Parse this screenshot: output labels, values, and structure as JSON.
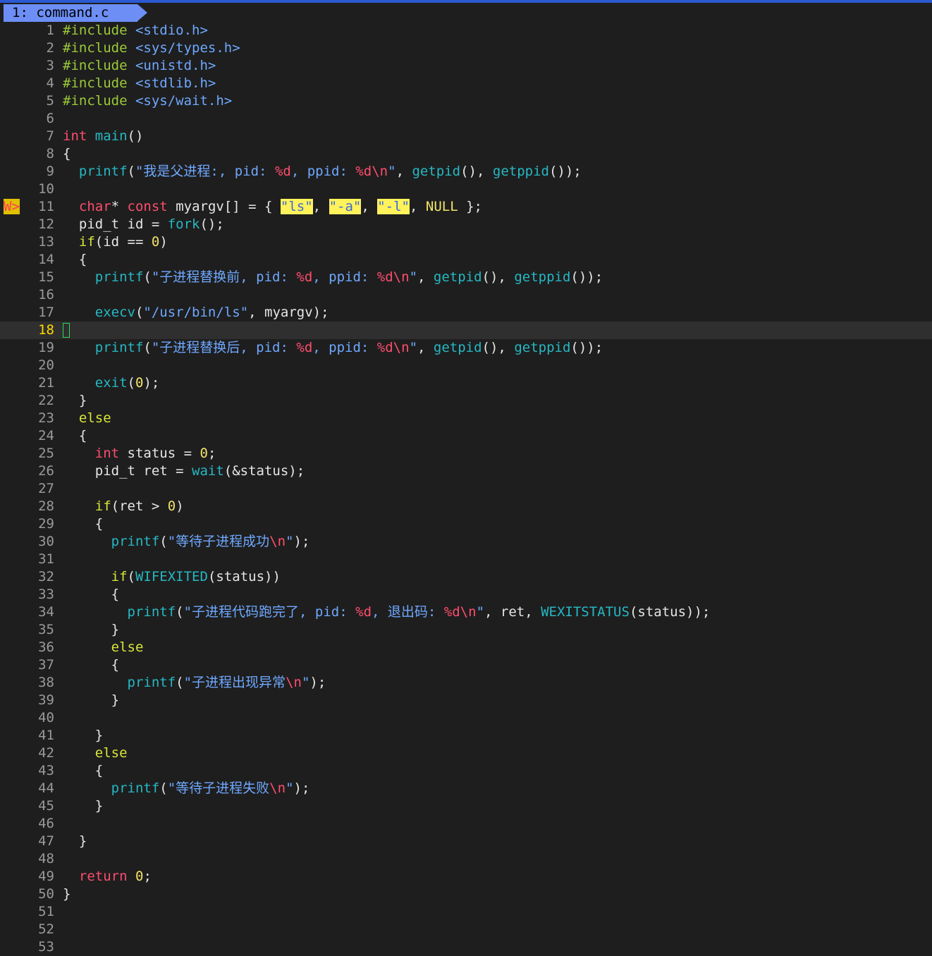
{
  "tab": {
    "label": "1: command.c"
  },
  "sign_marker": "W>",
  "cursor_line": 18,
  "lines": [
    {
      "n": "1",
      "tokens": [
        [
          "t-inc",
          "#include "
        ],
        [
          "t-hdr",
          "<stdio.h>"
        ]
      ]
    },
    {
      "n": "2",
      "tokens": [
        [
          "t-inc",
          "#include "
        ],
        [
          "t-hdr",
          "<sys/types.h>"
        ]
      ]
    },
    {
      "n": "3",
      "tokens": [
        [
          "t-inc",
          "#include "
        ],
        [
          "t-hdr",
          "<unistd.h>"
        ]
      ]
    },
    {
      "n": "4",
      "tokens": [
        [
          "t-inc",
          "#include "
        ],
        [
          "t-hdr",
          "<stdlib.h>"
        ]
      ]
    },
    {
      "n": "5",
      "tokens": [
        [
          "t-inc",
          "#include "
        ],
        [
          "t-hdr",
          "<sys/wait.h>"
        ]
      ]
    },
    {
      "n": "6",
      "tokens": []
    },
    {
      "n": "7",
      "tokens": [
        [
          "t-kw",
          "int "
        ],
        [
          "t-fn",
          "main"
        ],
        [
          "t-pl",
          "()"
        ]
      ]
    },
    {
      "n": "8",
      "tokens": [
        [
          "t-pl",
          "{"
        ]
      ]
    },
    {
      "n": "9",
      "tokens": [
        [
          "t-pl",
          "  "
        ],
        [
          "t-fn",
          "printf"
        ],
        [
          "t-pl",
          "("
        ],
        [
          "t-str",
          "\"我是父进程:, pid: "
        ],
        [
          "t-fmt",
          "%d"
        ],
        [
          "t-str",
          ", ppid: "
        ],
        [
          "t-fmt",
          "%d"
        ],
        [
          "t-esc",
          "\\n"
        ],
        [
          "t-str",
          "\""
        ],
        [
          "t-pl",
          ", "
        ],
        [
          "t-fn",
          "getpid"
        ],
        [
          "t-pl",
          "(), "
        ],
        [
          "t-fn",
          "getppid"
        ],
        [
          "t-pl",
          "());"
        ]
      ]
    },
    {
      "n": "10",
      "tokens": []
    },
    {
      "n": "11",
      "sign": true,
      "tokens": [
        [
          "t-pl",
          "  "
        ],
        [
          "t-kw",
          "char"
        ],
        [
          "t-pl",
          "* "
        ],
        [
          "t-kw",
          "const"
        ],
        [
          "t-pl",
          " myargv[] = { "
        ],
        [
          "t-hl",
          "\"ls\""
        ],
        [
          "t-pl",
          ", "
        ],
        [
          "t-hl",
          "\"-a\""
        ],
        [
          "t-pl",
          ", "
        ],
        [
          "t-hl",
          "\"-l\""
        ],
        [
          "t-pl",
          ", "
        ],
        [
          "t-nul",
          "NULL"
        ],
        [
          "t-pl",
          " };"
        ]
      ]
    },
    {
      "n": "12",
      "tokens": [
        [
          "t-pl",
          "  pid_t id = "
        ],
        [
          "t-fn",
          "fork"
        ],
        [
          "t-pl",
          "();"
        ]
      ]
    },
    {
      "n": "13",
      "tokens": [
        [
          "t-pl",
          "  "
        ],
        [
          "t-ctl",
          "if"
        ],
        [
          "t-pl",
          "(id == "
        ],
        [
          "t-num",
          "0"
        ],
        [
          "t-pl",
          ")"
        ]
      ]
    },
    {
      "n": "14",
      "tokens": [
        [
          "t-pl",
          "  {"
        ]
      ]
    },
    {
      "n": "15",
      "tokens": [
        [
          "t-pl",
          "    "
        ],
        [
          "t-fn",
          "printf"
        ],
        [
          "t-pl",
          "("
        ],
        [
          "t-str",
          "\"子进程替换前, pid: "
        ],
        [
          "t-fmt",
          "%d"
        ],
        [
          "t-str",
          ", ppid: "
        ],
        [
          "t-fmt",
          "%d"
        ],
        [
          "t-esc",
          "\\n"
        ],
        [
          "t-str",
          "\""
        ],
        [
          "t-pl",
          ", "
        ],
        [
          "t-fn",
          "getpid"
        ],
        [
          "t-pl",
          "(), "
        ],
        [
          "t-fn",
          "getppid"
        ],
        [
          "t-pl",
          "());"
        ]
      ]
    },
    {
      "n": "16",
      "tokens": []
    },
    {
      "n": "17",
      "tokens": [
        [
          "t-pl",
          "    "
        ],
        [
          "t-fn",
          "execv"
        ],
        [
          "t-pl",
          "("
        ],
        [
          "t-str",
          "\"/usr/bin/ls\""
        ],
        [
          "t-pl",
          ", myargv);"
        ]
      ]
    },
    {
      "n": "18",
      "tokens": []
    },
    {
      "n": "19",
      "tokens": [
        [
          "t-pl",
          "    "
        ],
        [
          "t-fn",
          "printf"
        ],
        [
          "t-pl",
          "("
        ],
        [
          "t-str",
          "\"子进程替换后, pid: "
        ],
        [
          "t-fmt",
          "%d"
        ],
        [
          "t-str",
          ", ppid: "
        ],
        [
          "t-fmt",
          "%d"
        ],
        [
          "t-esc",
          "\\n"
        ],
        [
          "t-str",
          "\""
        ],
        [
          "t-pl",
          ", "
        ],
        [
          "t-fn",
          "getpid"
        ],
        [
          "t-pl",
          "(), "
        ],
        [
          "t-fn",
          "getppid"
        ],
        [
          "t-pl",
          "());"
        ]
      ]
    },
    {
      "n": "20",
      "tokens": []
    },
    {
      "n": "21",
      "tokens": [
        [
          "t-pl",
          "    "
        ],
        [
          "t-fn",
          "exit"
        ],
        [
          "t-pl",
          "("
        ],
        [
          "t-num",
          "0"
        ],
        [
          "t-pl",
          ");"
        ]
      ]
    },
    {
      "n": "22",
      "tokens": [
        [
          "t-pl",
          "  }"
        ]
      ]
    },
    {
      "n": "23",
      "tokens": [
        [
          "t-pl",
          "  "
        ],
        [
          "t-ctl",
          "else"
        ]
      ]
    },
    {
      "n": "24",
      "tokens": [
        [
          "t-pl",
          "  {"
        ]
      ]
    },
    {
      "n": "25",
      "tokens": [
        [
          "t-pl",
          "    "
        ],
        [
          "t-kw",
          "int"
        ],
        [
          "t-pl",
          " status = "
        ],
        [
          "t-num",
          "0"
        ],
        [
          "t-pl",
          ";"
        ]
      ]
    },
    {
      "n": "26",
      "tokens": [
        [
          "t-pl",
          "    pid_t ret = "
        ],
        [
          "t-fn",
          "wait"
        ],
        [
          "t-pl",
          "(&status);"
        ]
      ]
    },
    {
      "n": "27",
      "tokens": []
    },
    {
      "n": "28",
      "tokens": [
        [
          "t-pl",
          "    "
        ],
        [
          "t-ctl",
          "if"
        ],
        [
          "t-pl",
          "(ret > "
        ],
        [
          "t-num",
          "0"
        ],
        [
          "t-pl",
          ")"
        ]
      ]
    },
    {
      "n": "29",
      "tokens": [
        [
          "t-pl",
          "    {"
        ]
      ]
    },
    {
      "n": "30",
      "tokens": [
        [
          "t-pl",
          "      "
        ],
        [
          "t-fn",
          "printf"
        ],
        [
          "t-pl",
          "("
        ],
        [
          "t-str",
          "\"等待子进程成功"
        ],
        [
          "t-esc",
          "\\n"
        ],
        [
          "t-str",
          "\""
        ],
        [
          "t-pl",
          ");"
        ]
      ]
    },
    {
      "n": "31",
      "tokens": []
    },
    {
      "n": "32",
      "tokens": [
        [
          "t-pl",
          "      "
        ],
        [
          "t-ctl",
          "if"
        ],
        [
          "t-pl",
          "("
        ],
        [
          "t-mac",
          "WIFEXITED"
        ],
        [
          "t-pl",
          "(status))"
        ]
      ]
    },
    {
      "n": "33",
      "tokens": [
        [
          "t-pl",
          "      {"
        ]
      ]
    },
    {
      "n": "34",
      "tokens": [
        [
          "t-pl",
          "        "
        ],
        [
          "t-fn",
          "printf"
        ],
        [
          "t-pl",
          "("
        ],
        [
          "t-str",
          "\"子进程代码跑完了, pid: "
        ],
        [
          "t-fmt",
          "%d"
        ],
        [
          "t-str",
          ", 退出码: "
        ],
        [
          "t-fmt",
          "%d"
        ],
        [
          "t-esc",
          "\\n"
        ],
        [
          "t-str",
          "\""
        ],
        [
          "t-pl",
          ", ret, "
        ],
        [
          "t-mac",
          "WEXITSTATUS"
        ],
        [
          "t-pl",
          "(status));"
        ]
      ]
    },
    {
      "n": "35",
      "tokens": [
        [
          "t-pl",
          "      }"
        ]
      ]
    },
    {
      "n": "36",
      "tokens": [
        [
          "t-pl",
          "      "
        ],
        [
          "t-ctl",
          "else"
        ]
      ]
    },
    {
      "n": "37",
      "tokens": [
        [
          "t-pl",
          "      {"
        ]
      ]
    },
    {
      "n": "38",
      "tokens": [
        [
          "t-pl",
          "        "
        ],
        [
          "t-fn",
          "printf"
        ],
        [
          "t-pl",
          "("
        ],
        [
          "t-str",
          "\"子进程出现异常"
        ],
        [
          "t-esc",
          "\\n"
        ],
        [
          "t-str",
          "\""
        ],
        [
          "t-pl",
          ");"
        ]
      ]
    },
    {
      "n": "39",
      "tokens": [
        [
          "t-pl",
          "      }"
        ]
      ]
    },
    {
      "n": "40",
      "tokens": []
    },
    {
      "n": "41",
      "tokens": [
        [
          "t-pl",
          "    }"
        ]
      ]
    },
    {
      "n": "42",
      "tokens": [
        [
          "t-pl",
          "    "
        ],
        [
          "t-ctl",
          "else"
        ]
      ]
    },
    {
      "n": "43",
      "tokens": [
        [
          "t-pl",
          "    {"
        ]
      ]
    },
    {
      "n": "44",
      "tokens": [
        [
          "t-pl",
          "      "
        ],
        [
          "t-fn",
          "printf"
        ],
        [
          "t-pl",
          "("
        ],
        [
          "t-str",
          "\"等待子进程失败"
        ],
        [
          "t-esc",
          "\\n"
        ],
        [
          "t-str",
          "\""
        ],
        [
          "t-pl",
          ");"
        ]
      ]
    },
    {
      "n": "45",
      "tokens": [
        [
          "t-pl",
          "    }"
        ]
      ]
    },
    {
      "n": "46",
      "tokens": []
    },
    {
      "n": "47",
      "tokens": [
        [
          "t-pl",
          "  }"
        ]
      ]
    },
    {
      "n": "48",
      "tokens": []
    },
    {
      "n": "49",
      "tokens": [
        [
          "t-pl",
          "  "
        ],
        [
          "t-kw",
          "return"
        ],
        [
          "t-pl",
          " "
        ],
        [
          "t-num",
          "0"
        ],
        [
          "t-pl",
          ";"
        ]
      ]
    },
    {
      "n": "50",
      "tokens": [
        [
          "t-pl",
          "}"
        ]
      ]
    },
    {
      "n": "51",
      "tokens": []
    },
    {
      "n": "52",
      "tokens": []
    },
    {
      "n": "53",
      "tokens": []
    }
  ]
}
